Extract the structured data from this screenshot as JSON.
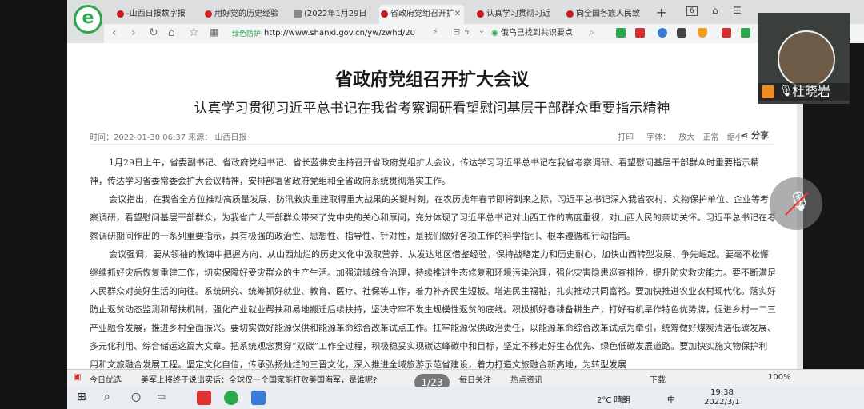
{
  "browser": {
    "tabs": [
      {
        "label": "-山西日报数字报",
        "active": false,
        "icon_color": "#c8161d"
      },
      {
        "label": "用好党的历史经验",
        "active": false,
        "icon_color": "#d02020"
      },
      {
        "label": "(2022年1月29日",
        "active": false,
        "icon_color": "#888888"
      },
      {
        "label": "省政府党组召开扩",
        "active": true,
        "icon_color": "#c8161d"
      },
      {
        "label": "认真学习贯彻习近",
        "active": false,
        "icon_color": "#c8161d"
      },
      {
        "label": "向全国各族人民致",
        "active": false,
        "icon_color": "#c8161d"
      }
    ],
    "new_tab": "+",
    "tab_count": "6",
    "address": "http://www.shanxi.gov.cn/yw/zwhd/20",
    "site_badge": "绿色防护",
    "search_text": "俄乌已找到共识要点"
  },
  "article": {
    "title": "省政府党组召开扩大会议",
    "subtitle": "认真学习贯彻习近平总书记在我省考察调研看望慰问基层干部群众重要指示精神",
    "meta": "时间：2022-01-30 06:37    来源：   山西日报",
    "tools": [
      "打印",
      "字体：",
      "放大",
      "正常",
      "缩小"
    ],
    "share": "分享",
    "paragraphs": [
      "1月29日上午，省委副书记、省政府党组书记、省长蓝佛安主持召开省政府党组扩大会议，传达学习习近平总书记在我省考察调研、看望慰问基层干部群众时重要指示精神，传达学习省委常委会扩大会议精神，安排部署省政府党组和全省政府系统贯彻落实工作。",
      "会议指出，在我省全方位推动高质量发展、防汛救灾重建取得重大战果的关键时刻，在农历虎年春节即将到来之际，习近平总书记深入我省农村、文物保护单位、企业等考察调研，看望慰问基层干部群众，为我省广大干部群众带来了党中央的关心和厚问，充分体现了习近平总书记对山西工作的高度重视，对山西人民的亲切关怀。习近平总书记在考察调研期间作出的一系列重要指示，具有极强的政治性、思想性、指导性、针对性，是我们做好各项工作的科学指引、根本遵循和行动指南。",
      "会议强调，要从领袖的教诲中把握方向、从山西灿烂的历史文化中汲取营养、从发达地区借鉴经验，保持战略定力和历史耐心，加快山西转型发展、争先崛起。要毫不松懈继续抓好灾后恢复重建工作，切实保障好受灾群众的生产生活。加强流域综合治理，持续推进生态修复和环境污染治理，强化灾害隐患巡查排险，提升防灾救灾能力。要不断满足人民群众对美好生活的向往。系统研究、统筹抓好就业、教育、医疗、社保等工作，着力补齐民生短板、增进民生福祉，扎实推动共同富裕。要加快推进农业农村现代化。落实好防止返贫动态监测和帮扶机制，强化产业就业帮扶和易地搬迁后续扶持，坚决守牢不发生规模性返贫的底线。积极抓好春耕备耕生产，打好有机旱作特色优势牌，促进乡村一二三产业融合发展，推进乡村全面振兴。要切实做好能源保供和能源革命综合改革试点工作。扛牢能源保供政治责任，以能源革命综合改革试点为牵引，统筹做好煤炭清洁低碳发展、多元化利用、综合储运这篇大文章。把系统观念贯穿“双碳”工作全过程，积极稳妥实现碳达峰碳中和目标，坚定不移走好生态优先、绿色低碳发展道路。要加快实施文物保护利用和文旅融合发展工程。坚定文化自信，传承弘扬灿烂的三晋文化，深入推进全域旅游示范省建设，着力打造文旅融合新高地，为转型发展"
    ]
  },
  "newsbar": {
    "label": "今日优选",
    "headline": "美军上将终于说出实话：全球仅一个国家能打败美国海军，是谁呢?",
    "page_counter": "1/23",
    "daily": "每日关注",
    "hot": "热点资讯",
    "download": "下载",
    "zoom": "100%"
  },
  "taskbar": {
    "weather": "2°C  晴朗",
    "time": "19:38",
    "date": "2022/3/1",
    "ime": "中"
  },
  "video": {
    "username": "杜晓岩"
  },
  "colors": {
    "logo_green": "#2aa84b",
    "brand_red": "#c8161d",
    "page_bg": "#ffffff"
  }
}
